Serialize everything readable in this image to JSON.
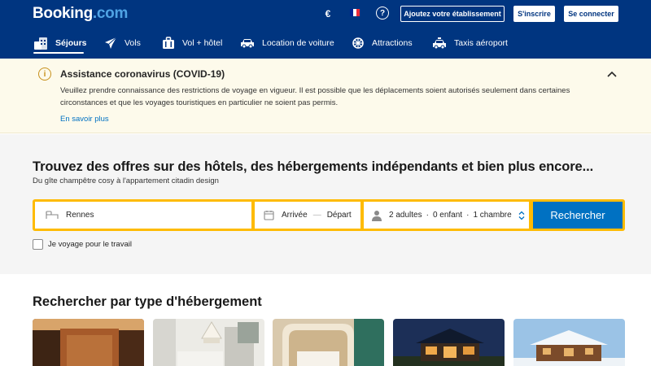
{
  "header": {
    "logo_main": "Booking",
    "logo_dot": ".com",
    "currency": "€",
    "list_property_label": "Ajoutez votre établissement",
    "register_label": "S'inscrire",
    "login_label": "Se connecter",
    "help_glyph": "?",
    "flag_colors": [
      "#002395",
      "#ffffff",
      "#ed2939"
    ]
  },
  "nav": {
    "items": [
      {
        "label": "Séjours",
        "icon": "bed-icon",
        "active": true
      },
      {
        "label": "Vols",
        "icon": "plane-icon"
      },
      {
        "label": "Vol + hôtel",
        "icon": "suitcase-icon"
      },
      {
        "label": "Location de voiture",
        "icon": "car-icon"
      },
      {
        "label": "Attractions",
        "icon": "ferris-wheel-icon"
      },
      {
        "label": "Taxis aéroport",
        "icon": "taxi-icon"
      }
    ]
  },
  "covid": {
    "title": "Assistance coronavirus (COVID-19)",
    "text": "Veuillez prendre connaissance des restrictions de voyage en vigueur. Il est possible que les déplacements soient autorisés seulement dans certaines circonstances et que les voyages touristiques en particulier ne soient pas permis.",
    "link": "En savoir plus",
    "icon_glyph": "i"
  },
  "search": {
    "headline": "Trouvez des offres sur des hôtels, des hébergements indépendants et bien plus encore...",
    "subline": "Du gîte champêtre cosy à l'appartement citadin design",
    "destination": "Rennes",
    "checkin": "Arrivée",
    "date_separator": "—",
    "checkout": "Départ",
    "adults": "2 adultes",
    "children": "0 enfant",
    "rooms": "1 chambre",
    "bullet": "·",
    "button": "Rechercher",
    "work_travel": "Je voyage pour le travail"
  },
  "property_types": {
    "title": "Rechercher par type d'hébergement"
  },
  "colors": {
    "brand_blue": "#003580",
    "accent_blue": "#0071c2",
    "search_yellow": "#febb02",
    "banner_bg": "#fdfaeb",
    "warning_icon": "#c7901b"
  }
}
